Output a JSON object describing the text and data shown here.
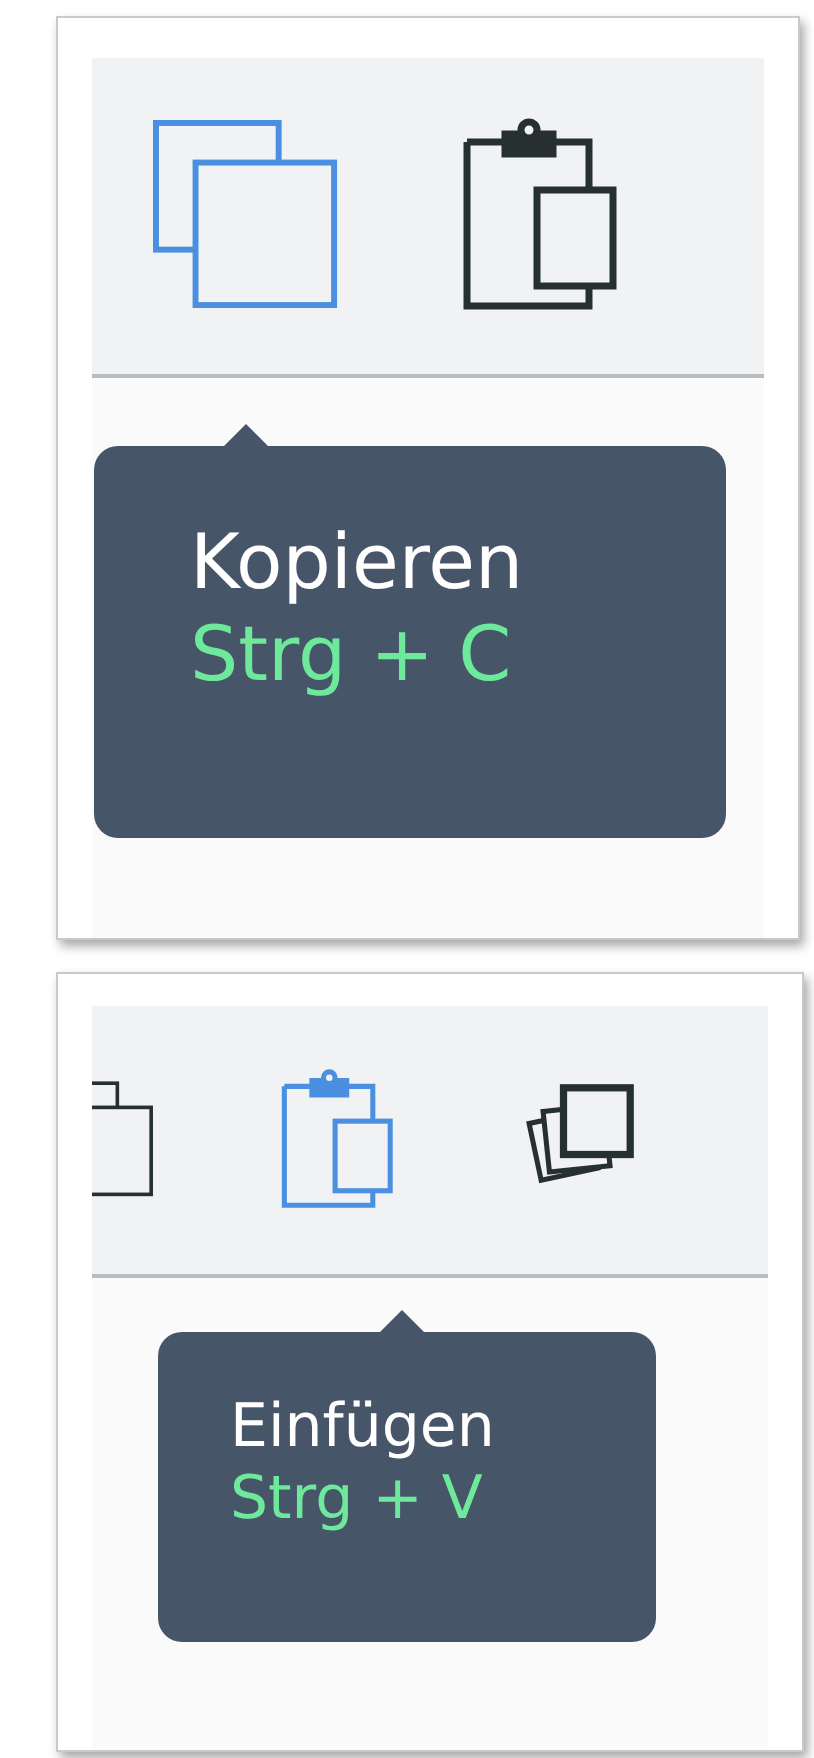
{
  "panels": [
    {
      "toolbar": [
        {
          "kind": "copy",
          "selected": true
        },
        {
          "kind": "paste",
          "selected": false
        }
      ],
      "tooltip": {
        "label": "Kopieren",
        "shortcut": "Strg + C"
      }
    },
    {
      "toolbar": [
        {
          "kind": "copy",
          "selected": false
        },
        {
          "kind": "paste",
          "selected": true
        },
        {
          "kind": "stack",
          "selected": false
        }
      ],
      "tooltip": {
        "label": "Einfügen",
        "shortcut": "Strg + V"
      }
    }
  ]
}
